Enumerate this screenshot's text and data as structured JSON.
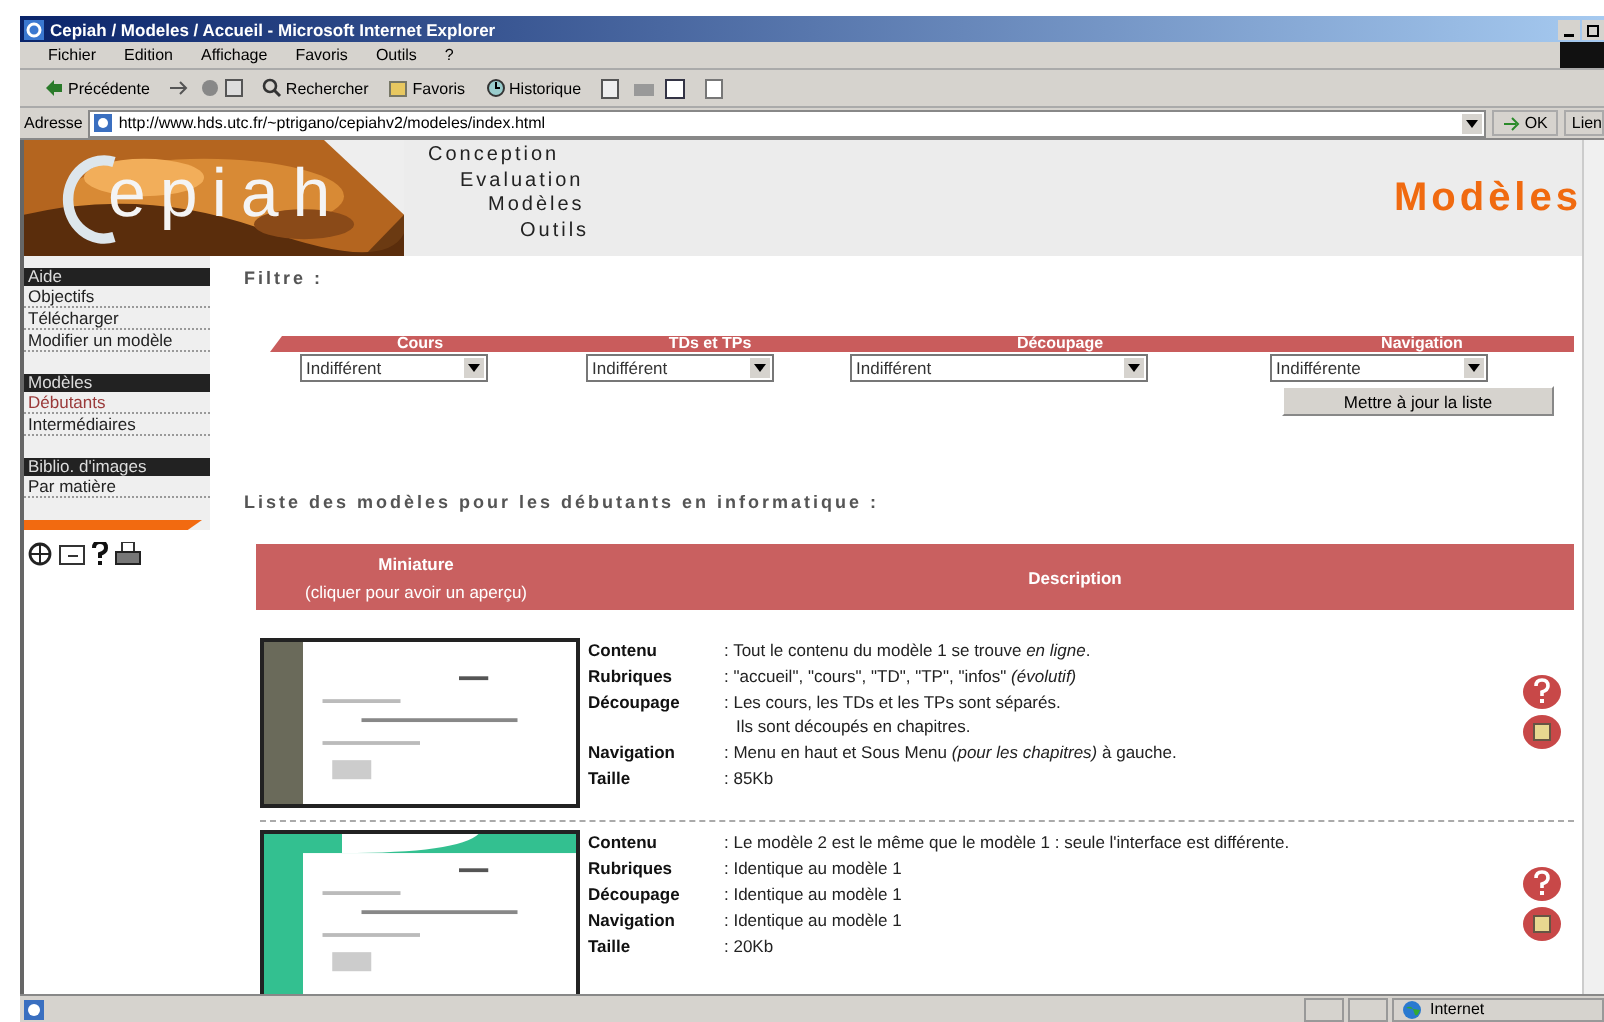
{
  "window": {
    "title": "Cepiah / Modeles / Accueil - Microsoft Internet Explorer"
  },
  "menu": [
    "Fichier",
    "Edition",
    "Affichage",
    "Favoris",
    "Outils",
    "?"
  ],
  "toolbar": [
    {
      "kind": "back",
      "label": "Précédente"
    },
    {
      "kind": "search",
      "label": "Rechercher"
    },
    {
      "kind": "favorites",
      "label": "Favoris"
    },
    {
      "kind": "history",
      "label": "Historique"
    }
  ],
  "address": {
    "label": "Adresse",
    "value": "http://www.hds.utc.fr/~ptrigano/cepiahv2/modeles/index.html",
    "go": "OK",
    "links": "Lien"
  },
  "banner": {
    "logo": "epiah",
    "nav": [
      "Conception",
      "Evaluation",
      "Modèles",
      "Outils"
    ],
    "title": "Modèles"
  },
  "sidebar": [
    {
      "title": "Aide",
      "items": [
        {
          "label": "Objectifs",
          "selected": false
        },
        {
          "label": "Télécharger",
          "selected": false
        },
        {
          "label": "Modifier un modèle",
          "selected": false
        }
      ]
    },
    {
      "title": "Modèles",
      "items": [
        {
          "label": "Débutants",
          "selected": true
        },
        {
          "label": "Intermédiaires",
          "selected": false
        }
      ]
    },
    {
      "title": "Biblio. d'images",
      "items": [
        {
          "label": "Par matière",
          "selected": false
        }
      ]
    }
  ],
  "filter": {
    "title": "Filtre :",
    "fields": [
      {
        "label": "Cours",
        "value": "Indifférent"
      },
      {
        "label": "TDs et TPs",
        "value": "Indifférent"
      },
      {
        "label": "Découpage",
        "value": "Indifférent"
      },
      {
        "label": "Navigation",
        "value": "Indifférente"
      }
    ],
    "button": "Mettre à jour la liste"
  },
  "list": {
    "title": "Liste des modèles pour les débutants en informatique :",
    "columns": [
      {
        "label": "Miniature",
        "hint": "(cliquer pour avoir un aperçu)"
      },
      {
        "label": "Description"
      }
    ],
    "rows": [
      {
        "fields": [
          {
            "label": "Contenu",
            "lines": [
              ": Tout le contenu du modèle 1 se trouve *en ligne*."
            ]
          },
          {
            "label": "Rubriques",
            "lines": [
              ": \"accueil\", \"cours\", \"TD\", \"TP\", \"infos\" *(évolutif)*"
            ]
          },
          {
            "label": "Découpage",
            "lines": [
              ": Les cours, les TDs et les TPs sont séparés.",
              "Ils sont découpés en chapitres."
            ]
          },
          {
            "label": "Navigation",
            "lines": [
              ": Menu en haut et Sous Menu *(pour les chapitres)* à gauche."
            ]
          },
          {
            "label": "Taille",
            "lines": [
              ": 85Kb"
            ]
          }
        ]
      },
      {
        "fields": [
          {
            "label": "Contenu",
            "lines": [
              ": Le modèle 2 est le même que le modèle 1 : seule l'interface est différente."
            ]
          },
          {
            "label": "Rubriques",
            "lines": [
              ": Identique au modèle 1"
            ]
          },
          {
            "label": "Découpage",
            "lines": [
              ": Identique au modèle 1"
            ]
          },
          {
            "label": "Navigation",
            "lines": [
              ": Identique au modèle 1"
            ]
          },
          {
            "label": "Taille",
            "lines": [
              ": 20Kb"
            ]
          }
        ]
      }
    ]
  },
  "status_bar": {
    "zone": "Internet"
  }
}
